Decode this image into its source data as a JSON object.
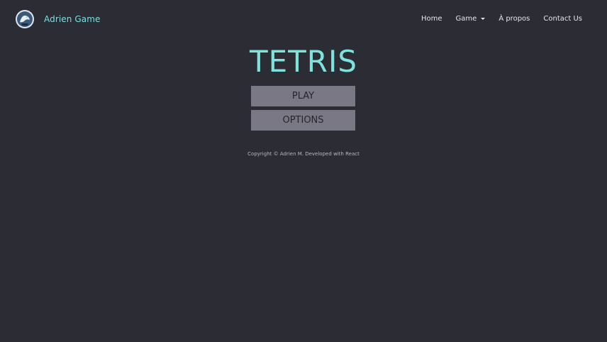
{
  "header": {
    "brand_name": "Adrien Game",
    "logo_icon": "logo-icon",
    "nav": [
      {
        "label": "Home"
      },
      {
        "label": "Game",
        "dropdown": true
      },
      {
        "label": "À propos"
      },
      {
        "label": "Contact Us"
      }
    ]
  },
  "main": {
    "title": "TETRIS",
    "play_label": "PLAY",
    "options_label": "OPTIONS"
  },
  "footer": {
    "copyright": "Copyright © Adrien M. Developed with React"
  },
  "colors": {
    "background": "#2c2c35",
    "accent": "#7ee3dc",
    "button": "#7b7885"
  }
}
